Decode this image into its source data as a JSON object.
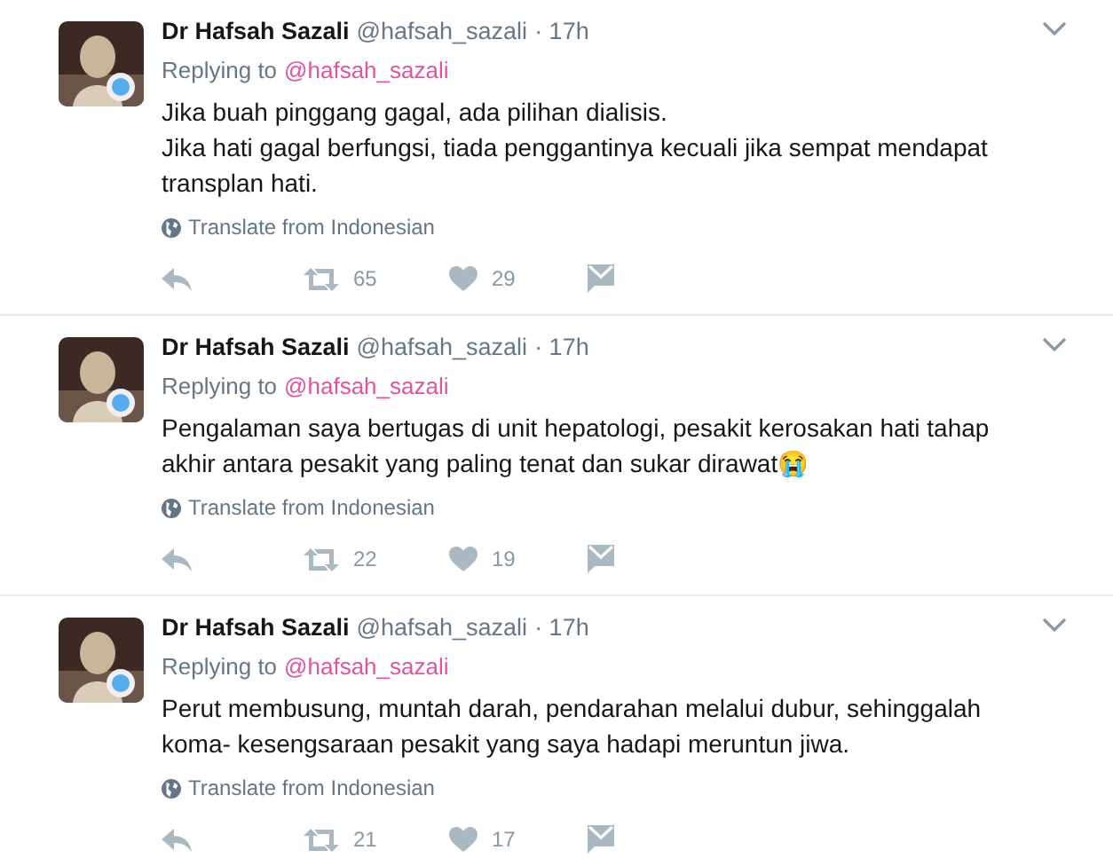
{
  "tweets": [
    {
      "name": "Dr Hafsah Sazali",
      "handle": "@hafsah_sazali",
      "time": "· 17h",
      "replying_label": "Replying to",
      "replying_to": "@hafsah_sazali",
      "text": "Jika buah pinggang gagal, ada pilihan dialisis.\nJika hati gagal berfungsi, tiada penggantinya kecuali jika sempat mendapat transplan hati.",
      "translate": "Translate from Indonesian",
      "retweets": "65",
      "likes": "29"
    },
    {
      "name": "Dr Hafsah Sazali",
      "handle": "@hafsah_sazali",
      "time": "· 17h",
      "replying_label": "Replying to",
      "replying_to": "@hafsah_sazali",
      "text": "Pengalaman saya bertugas di unit hepatologi, pesakit kerosakan hati tahap akhir antara pesakit yang paling tenat dan sukar dirawat😭",
      "translate": "Translate from Indonesian",
      "retweets": "22",
      "likes": "19"
    },
    {
      "name": "Dr Hafsah Sazali",
      "handle": "@hafsah_sazali",
      "time": "· 17h",
      "replying_label": "Replying to",
      "replying_to": "@hafsah_sazali",
      "text": "Perut membusung, muntah darah, pendarahan melalui dubur, sehinggalah koma- kesengsaraan pesakit yang saya hadapi meruntun jiwa.",
      "translate": "Translate from Indonesian",
      "retweets": "21",
      "likes": "17"
    }
  ]
}
